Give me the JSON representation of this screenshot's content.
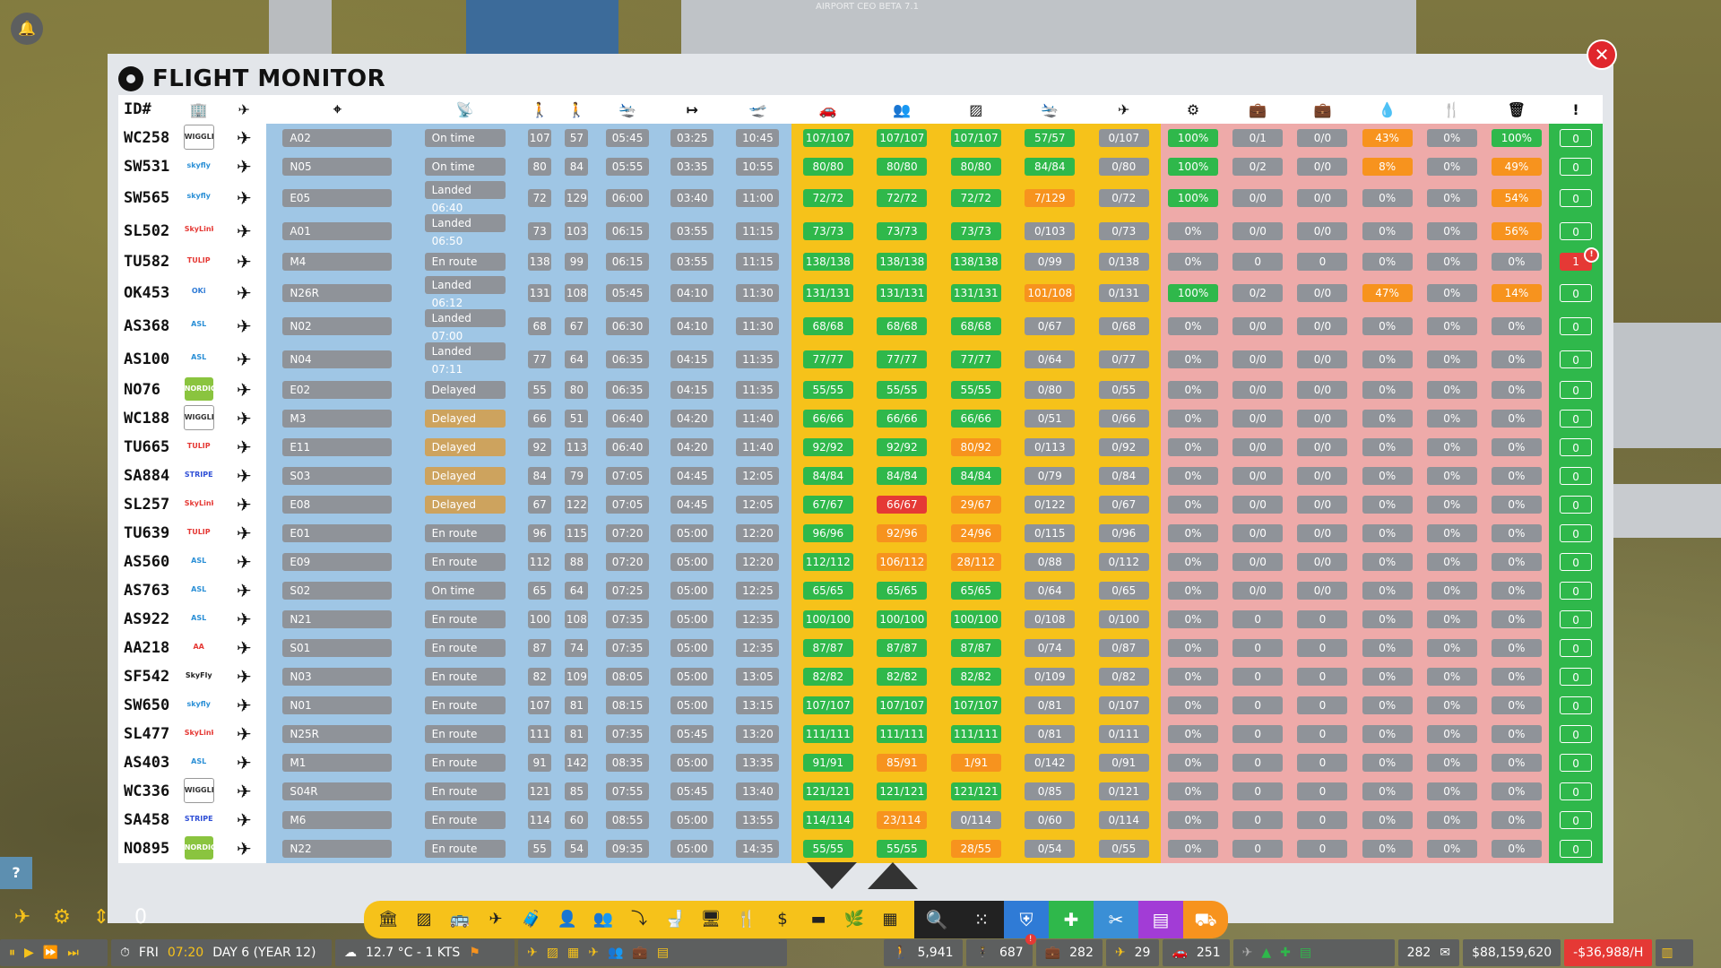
{
  "app": {
    "title": "FLIGHT MONITOR",
    "watermark": "AIRPORT CEO BETA 7.1"
  },
  "headers": {
    "id": "ID#"
  },
  "flights": [
    {
      "id": "WC258",
      "logo": "WIGGLEY",
      "gate": "A02",
      "status": "On time",
      "s1": "107",
      "s2": "57",
      "t1": "05:45",
      "t2": "03:25",
      "t3": "10:45",
      "f1": "107/107",
      "f2": "107/107",
      "f3": "107/107",
      "f4": "57/57",
      "f5": "0/107",
      "g1": "100%",
      "g2": "0/1",
      "g3": "0/0",
      "g4": "43%",
      "g5": "0%",
      "g6": "100%",
      "alerts": "0"
    },
    {
      "id": "SW531",
      "logo": "skyfly",
      "gate": "N05",
      "status": "On time",
      "s1": "80",
      "s2": "84",
      "t1": "05:55",
      "t2": "03:35",
      "t3": "10:55",
      "f1": "80/80",
      "f2": "80/80",
      "f3": "80/80",
      "f4": "84/84",
      "f5": "0/80",
      "g1": "100%",
      "g2": "0/2",
      "g3": "0/0",
      "g4": "8%",
      "g5": "0%",
      "g6": "49%",
      "alerts": "0"
    },
    {
      "id": "SW565",
      "logo": "skyfly",
      "gate": "E05",
      "status": "Landed 06:40",
      "s1": "72",
      "s2": "129",
      "t1": "06:00",
      "t2": "03:40",
      "t3": "11:00",
      "f1": "72/72",
      "f2": "72/72",
      "f3": "72/72",
      "f4": "7/129",
      "f5": "0/72",
      "g1": "100%",
      "g2": "0/0",
      "g3": "0/0",
      "g4": "0%",
      "g5": "0%",
      "g6": "54%",
      "alerts": "0"
    },
    {
      "id": "SL502",
      "logo": "SkyLink",
      "gate": "A01",
      "status": "Landed 06:50",
      "s1": "73",
      "s2": "103",
      "t1": "06:15",
      "t2": "03:55",
      "t3": "11:15",
      "f1": "73/73",
      "f2": "73/73",
      "f3": "73/73",
      "f4": "0/103",
      "f5": "0/73",
      "g1": "0%",
      "g2": "0/0",
      "g3": "0/0",
      "g4": "0%",
      "g5": "0%",
      "g6": "56%",
      "alerts": "0"
    },
    {
      "id": "TU582",
      "logo": "TULIP",
      "gate": "M4",
      "status": "En route",
      "s1": "138",
      "s2": "99",
      "t1": "06:15",
      "t2": "03:55",
      "t3": "11:15",
      "f1": "138/138",
      "f2": "138/138",
      "f3": "138/138",
      "f4": "0/99",
      "f5": "0/138",
      "g1": "0%",
      "g2": "0",
      "g3": "0",
      "g4": "0%",
      "g5": "0%",
      "g6": "0%",
      "alerts": "1",
      "alert_badge": "!"
    },
    {
      "id": "OK453",
      "logo": "OKi",
      "gate": "N26R",
      "status": "Landed 06:12",
      "s1": "131",
      "s2": "108",
      "t1": "05:45",
      "t2": "04:10",
      "t3": "11:30",
      "f1": "131/131",
      "f2": "131/131",
      "f3": "131/131",
      "f4": "101/108",
      "f5": "0/131",
      "g1": "100%",
      "g2": "0/2",
      "g3": "0/0",
      "g4": "47%",
      "g5": "0%",
      "g6": "14%",
      "alerts": "0"
    },
    {
      "id": "AS368",
      "logo": "ASL",
      "gate": "N02",
      "status": "Landed 07:00",
      "s1": "68",
      "s2": "67",
      "t1": "06:30",
      "t2": "04:10",
      "t3": "11:30",
      "f1": "68/68",
      "f2": "68/68",
      "f3": "68/68",
      "f4": "0/67",
      "f5": "0/68",
      "g1": "0%",
      "g2": "0/0",
      "g3": "0/0",
      "g4": "0%",
      "g5": "0%",
      "g6": "0%",
      "alerts": "0"
    },
    {
      "id": "AS100",
      "logo": "ASL",
      "gate": "N04",
      "status": "Landed 07:11",
      "s1": "77",
      "s2": "64",
      "t1": "06:35",
      "t2": "04:15",
      "t3": "11:35",
      "f1": "77/77",
      "f2": "77/77",
      "f3": "77/77",
      "f4": "0/64",
      "f5": "0/77",
      "g1": "0%",
      "g2": "0/0",
      "g3": "0/0",
      "g4": "0%",
      "g5": "0%",
      "g6": "0%",
      "alerts": "0"
    },
    {
      "id": "NO76",
      "logo": "NORDIC",
      "gate": "E02",
      "status": "Delayed",
      "s1": "55",
      "s2": "80",
      "t1": "06:35",
      "t2": "04:15",
      "t3": "11:35",
      "f1": "55/55",
      "f2": "55/55",
      "f3": "55/55",
      "f4": "0/80",
      "f5": "0/55",
      "g1": "0%",
      "g2": "0/0",
      "g3": "0/0",
      "g4": "0%",
      "g5": "0%",
      "g6": "0%",
      "alerts": "0"
    },
    {
      "id": "WC188",
      "logo": "WIGGLEY",
      "gate": "M3",
      "status": "Delayed",
      "s1": "66",
      "s2": "51",
      "t1": "06:40",
      "t2": "04:20",
      "t3": "11:40",
      "f1": "66/66",
      "f2": "66/66",
      "f3": "66/66",
      "f4": "0/51",
      "f5": "0/66",
      "g1": "0%",
      "g2": "0/0",
      "g3": "0/0",
      "g4": "0%",
      "g5": "0%",
      "g6": "0%",
      "alerts": "0"
    },
    {
      "id": "TU665",
      "logo": "TULIP",
      "gate": "E11",
      "status": "Delayed",
      "s1": "92",
      "s2": "113",
      "t1": "06:40",
      "t2": "04:20",
      "t3": "11:40",
      "f1": "92/92",
      "f2": "92/92",
      "f3": "80/92",
      "f4": "0/113",
      "f5": "0/92",
      "g1": "0%",
      "g2": "0/0",
      "g3": "0/0",
      "g4": "0%",
      "g5": "0%",
      "g6": "0%",
      "alerts": "0"
    },
    {
      "id": "SA884",
      "logo": "STRIPE",
      "gate": "S03",
      "status": "Delayed",
      "s1": "84",
      "s2": "79",
      "t1": "07:05",
      "t2": "04:45",
      "t3": "12:05",
      "f1": "84/84",
      "f2": "84/84",
      "f3": "84/84",
      "f4": "0/79",
      "f5": "0/84",
      "g1": "0%",
      "g2": "0/0",
      "g3": "0/0",
      "g4": "0%",
      "g5": "0%",
      "g6": "0%",
      "alerts": "0"
    },
    {
      "id": "SL257",
      "logo": "SkyLink",
      "gate": "E08",
      "status": "Delayed",
      "s1": "67",
      "s2": "122",
      "t1": "07:05",
      "t2": "04:45",
      "t3": "12:05",
      "f1": "67/67",
      "f2": "66/67",
      "f3": "29/67",
      "f4": "0/122",
      "f5": "0/67",
      "g1": "0%",
      "g2": "0/0",
      "g3": "0/0",
      "g4": "0%",
      "g5": "0%",
      "g6": "0%",
      "alerts": "0"
    },
    {
      "id": "TU639",
      "logo": "TULIP",
      "gate": "E01",
      "status": "En route",
      "s1": "96",
      "s2": "115",
      "t1": "07:20",
      "t2": "05:00",
      "t3": "12:20",
      "f1": "96/96",
      "f2": "92/96",
      "f3": "24/96",
      "f4": "0/115",
      "f5": "0/96",
      "g1": "0%",
      "g2": "0/0",
      "g3": "0/0",
      "g4": "0%",
      "g5": "0%",
      "g6": "0%",
      "alerts": "0"
    },
    {
      "id": "AS560",
      "logo": "ASL",
      "gate": "E09",
      "status": "En route",
      "s1": "112",
      "s2": "88",
      "t1": "07:20",
      "t2": "05:00",
      "t3": "12:20",
      "f1": "112/112",
      "f2": "106/112",
      "f3": "28/112",
      "f4": "0/88",
      "f5": "0/112",
      "g1": "0%",
      "g2": "0/0",
      "g3": "0/0",
      "g4": "0%",
      "g5": "0%",
      "g6": "0%",
      "alerts": "0"
    },
    {
      "id": "AS763",
      "logo": "ASL",
      "gate": "S02",
      "status": "On time",
      "s1": "65",
      "s2": "64",
      "t1": "07:25",
      "t2": "05:00",
      "t3": "12:25",
      "f1": "65/65",
      "f2": "65/65",
      "f3": "65/65",
      "f4": "0/64",
      "f5": "0/65",
      "g1": "0%",
      "g2": "0/0",
      "g3": "0/0",
      "g4": "0%",
      "g5": "0%",
      "g6": "0%",
      "alerts": "0"
    },
    {
      "id": "AS922",
      "logo": "ASL",
      "gate": "N21",
      "status": "En route",
      "s1": "100",
      "s2": "108",
      "t1": "07:35",
      "t2": "05:00",
      "t3": "12:35",
      "f1": "100/100",
      "f2": "100/100",
      "f3": "100/100",
      "f4": "0/108",
      "f5": "0/100",
      "g1": "0%",
      "g2": "0",
      "g3": "0",
      "g4": "0%",
      "g5": "0%",
      "g6": "0%",
      "alerts": "0"
    },
    {
      "id": "AA218",
      "logo": "AA",
      "gate": "S01",
      "status": "En route",
      "s1": "87",
      "s2": "74",
      "t1": "07:35",
      "t2": "05:00",
      "t3": "12:35",
      "f1": "87/87",
      "f2": "87/87",
      "f3": "87/87",
      "f4": "0/74",
      "f5": "0/87",
      "g1": "0%",
      "g2": "0",
      "g3": "0",
      "g4": "0%",
      "g5": "0%",
      "g6": "0%",
      "alerts": "0"
    },
    {
      "id": "SF542",
      "logo": "SkyFly",
      "gate": "N03",
      "status": "En route",
      "s1": "82",
      "s2": "109",
      "t1": "08:05",
      "t2": "05:00",
      "t3": "13:05",
      "f1": "82/82",
      "f2": "82/82",
      "f3": "82/82",
      "f4": "0/109",
      "f5": "0/82",
      "g1": "0%",
      "g2": "0",
      "g3": "0",
      "g4": "0%",
      "g5": "0%",
      "g6": "0%",
      "alerts": "0"
    },
    {
      "id": "SW650",
      "logo": "skyfly",
      "gate": "N01",
      "status": "En route",
      "s1": "107",
      "s2": "81",
      "t1": "08:15",
      "t2": "05:00",
      "t3": "13:15",
      "f1": "107/107",
      "f2": "107/107",
      "f3": "107/107",
      "f4": "0/81",
      "f5": "0/107",
      "g1": "0%",
      "g2": "0",
      "g3": "0",
      "g4": "0%",
      "g5": "0%",
      "g6": "0%",
      "alerts": "0"
    },
    {
      "id": "SL477",
      "logo": "SkyLink",
      "gate": "N25R",
      "status": "En route",
      "s1": "111",
      "s2": "81",
      "t1": "07:35",
      "t2": "05:45",
      "t3": "13:20",
      "f1": "111/111",
      "f2": "111/111",
      "f3": "111/111",
      "f4": "0/81",
      "f5": "0/111",
      "g1": "0%",
      "g2": "0",
      "g3": "0",
      "g4": "0%",
      "g5": "0%",
      "g6": "0%",
      "alerts": "0"
    },
    {
      "id": "AS403",
      "logo": "ASL",
      "gate": "M1",
      "status": "En route",
      "s1": "91",
      "s2": "142",
      "t1": "08:35",
      "t2": "05:00",
      "t3": "13:35",
      "f1": "91/91",
      "f2": "85/91",
      "f3": "1/91",
      "f4": "0/142",
      "f5": "0/91",
      "g1": "0%",
      "g2": "0",
      "g3": "0",
      "g4": "0%",
      "g5": "0%",
      "g6": "0%",
      "alerts": "0"
    },
    {
      "id": "WC336",
      "logo": "WIGGLEY",
      "gate": "S04R",
      "status": "En route",
      "s1": "121",
      "s2": "85",
      "t1": "07:55",
      "t2": "05:45",
      "t3": "13:40",
      "f1": "121/121",
      "f2": "121/121",
      "f3": "121/121",
      "f4": "0/85",
      "f5": "0/121",
      "g1": "0%",
      "g2": "0",
      "g3": "0",
      "g4": "0%",
      "g5": "0%",
      "g6": "0%",
      "alerts": "0"
    },
    {
      "id": "SA458",
      "logo": "STRIPE",
      "gate": "M6",
      "status": "En route",
      "s1": "114",
      "s2": "60",
      "t1": "08:55",
      "t2": "05:00",
      "t3": "13:55",
      "f1": "114/114",
      "f2": "23/114",
      "f3": "0/114",
      "f4": "0/60",
      "f5": "0/114",
      "g1": "0%",
      "g2": "0",
      "g3": "0",
      "g4": "0%",
      "g5": "0%",
      "g6": "0%",
      "alerts": "0"
    },
    {
      "id": "NO895",
      "logo": "NORDIC",
      "gate": "N22",
      "status": "En route",
      "s1": "55",
      "s2": "54",
      "t1": "09:35",
      "t2": "05:00",
      "t3": "14:35",
      "f1": "55/55",
      "f2": "55/55",
      "f3": "28/55",
      "f4": "0/54",
      "f5": "0/55",
      "g1": "0%",
      "g2": "0",
      "g3": "0",
      "g4": "0%",
      "g5": "0%",
      "g6": "0%",
      "alerts": "0"
    }
  ],
  "bottom": {
    "day": "FRI",
    "time": "07:20",
    "date": "DAY 6 (YEAR 12)",
    "weather": "12.7 °C - 1 KTS",
    "passengers": "5,941",
    "staff": "687",
    "staff_badge": "!",
    "bags": "282",
    "flights": "29",
    "vehicles": "251",
    "mail": "282",
    "money": "$88,159,620",
    "rate": "-$36,988/H",
    "counter": "0",
    "help": "?"
  },
  "colors": {
    "blue": "#9fc6e5",
    "yellow": "#f6c21a",
    "pink": "#eeaaa9",
    "green": "#2fb84b",
    "orange": "#f7931e",
    "red": "#e53935",
    "tan": "#cda35e",
    "pill": "#8f9399"
  }
}
